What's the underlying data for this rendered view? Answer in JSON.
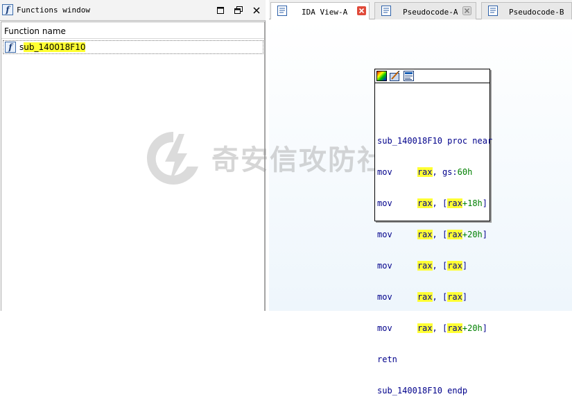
{
  "functions_window": {
    "title": "Functions window",
    "column_header": "Function name",
    "functions": [
      {
        "name_prefix": "s",
        "name_highlight": "ub_140018F10"
      }
    ]
  },
  "tabs": [
    {
      "label": "IDA View-A",
      "active": true
    },
    {
      "label": "Pseudocode-A",
      "active": false
    },
    {
      "label": "Pseudocode-B",
      "active": false
    }
  ],
  "watermark": {
    "text": "奇安信攻防社区"
  },
  "graph_node": {
    "lines": [
      {
        "text": "sub_140018F10 proc near"
      },
      {
        "mnemonic": "mov",
        "reg": "rax",
        "rest": ", gs:",
        "num": "60h"
      },
      {
        "mnemonic": "mov",
        "reg": "rax",
        "rest": ", [",
        "reg2": "rax",
        "num": "+18h",
        "close": "]"
      },
      {
        "mnemonic": "mov",
        "reg": "rax",
        "rest": ", [",
        "reg2": "rax",
        "num": "+20h",
        "close": "]"
      },
      {
        "mnemonic": "mov",
        "reg": "rax",
        "rest": ", [",
        "reg2": "rax",
        "close": "]"
      },
      {
        "mnemonic": "mov",
        "reg": "rax",
        "rest": ", [",
        "reg2": "rax",
        "close": "]"
      },
      {
        "mnemonic": "mov",
        "reg": "rax",
        "rest": ", [",
        "reg2": "rax",
        "num": "+20h",
        "close": "]"
      },
      {
        "text": "retn"
      },
      {
        "text": "sub_140018F10 endp"
      }
    ]
  },
  "colors": {
    "highlight": "#ffff33",
    "code": "#00008b",
    "number": "#008000",
    "tab_close_active": "#e04a3a"
  }
}
